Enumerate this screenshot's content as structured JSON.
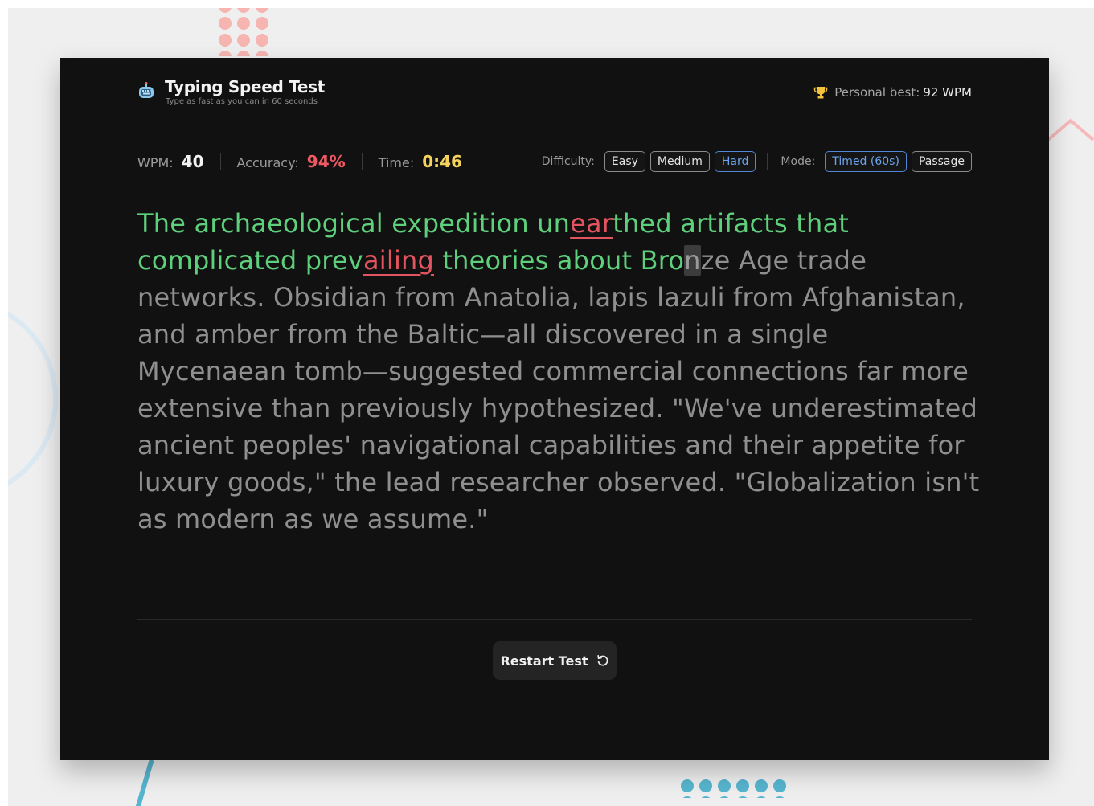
{
  "app": {
    "title": "Typing Speed Test",
    "subtitle": "Type as fast as you can in 60 seconds",
    "icon": "keyboard-robot-icon"
  },
  "personal_best": {
    "label": "Personal best:",
    "value": "92 WPM",
    "icon": "trophy-icon"
  },
  "stats": {
    "wpm_label": "WPM:",
    "wpm_value": "40",
    "accuracy_label": "Accuracy:",
    "accuracy_value": "94%",
    "time_label": "Time:",
    "time_value": "0:46"
  },
  "difficulty": {
    "label": "Difficulty:",
    "options": [
      "Easy",
      "Medium",
      "Hard"
    ],
    "selected": "Hard"
  },
  "mode": {
    "label": "Mode:",
    "options": [
      "Timed (60s)",
      "Passage"
    ],
    "selected": "Timed (60s)"
  },
  "passage": {
    "segments": [
      {
        "text": "The archaeological expedition un",
        "state": "correct"
      },
      {
        "text": "ear",
        "state": "wrong"
      },
      {
        "text": "thed artifacts that complicated prev",
        "state": "correct"
      },
      {
        "text": "ailing",
        "state": "wrong"
      },
      {
        "text": " theories about Bro",
        "state": "correct"
      },
      {
        "text": "n",
        "state": "cursor"
      },
      {
        "text": "ze Age trade networks. Obsidian from Anatolia, lapis lazuli from Afghanistan, and amber from the Baltic—all discovered in a single Mycenaean tomb—suggested commercial connections far more extensive than previously hypothesized. \"We've underestimated ancient peoples' navigational capabilities and their appetite for luxury goods,\" the lead researcher observed. \"Globalization isn't as modern as we assume.\"",
        "state": "pending"
      }
    ]
  },
  "restart": {
    "label": "Restart Test",
    "icon": "restart-icon"
  },
  "colors": {
    "correct": "#5ed07c",
    "wrong": "#e2545f",
    "pending": "#8f8f8f",
    "accuracy": "#ef5a64",
    "time": "#f3d35d",
    "active_pill": "#4f86d6"
  }
}
